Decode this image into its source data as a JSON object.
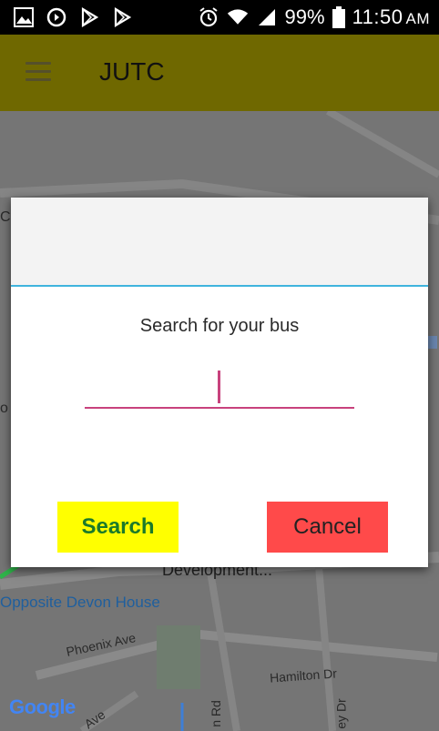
{
  "status_bar": {
    "left_icons": [
      "gallery-icon",
      "sync-icon",
      "play-store-icon",
      "play-store-icon"
    ],
    "right_icons": [
      "alarm-icon",
      "wifi-icon",
      "signal-icon",
      "battery-icon"
    ],
    "battery_percent": "99%",
    "time": "11:50",
    "ampm": "AM"
  },
  "toolbar": {
    "title": "JUTC",
    "menu_icon": "menu-icon",
    "background": "#6f6800"
  },
  "map": {
    "labels": {
      "development": "Development...",
      "devon_house": "Opposite Devon House",
      "phoenix": "Phoenix Ave",
      "hamilton": "Hamilton Dr",
      "rd": "n Rd",
      "ey_dr": "ey Dr",
      "ave": "Ave",
      "c_left": "C",
      "o_left": "o"
    },
    "attribution": "Google"
  },
  "dialog": {
    "prompt": "Search for your bus",
    "search_value": "",
    "search_button": "Search",
    "cancel_button": "Cancel",
    "accent": "#3fb4dd",
    "field_color": "#c8427d"
  }
}
